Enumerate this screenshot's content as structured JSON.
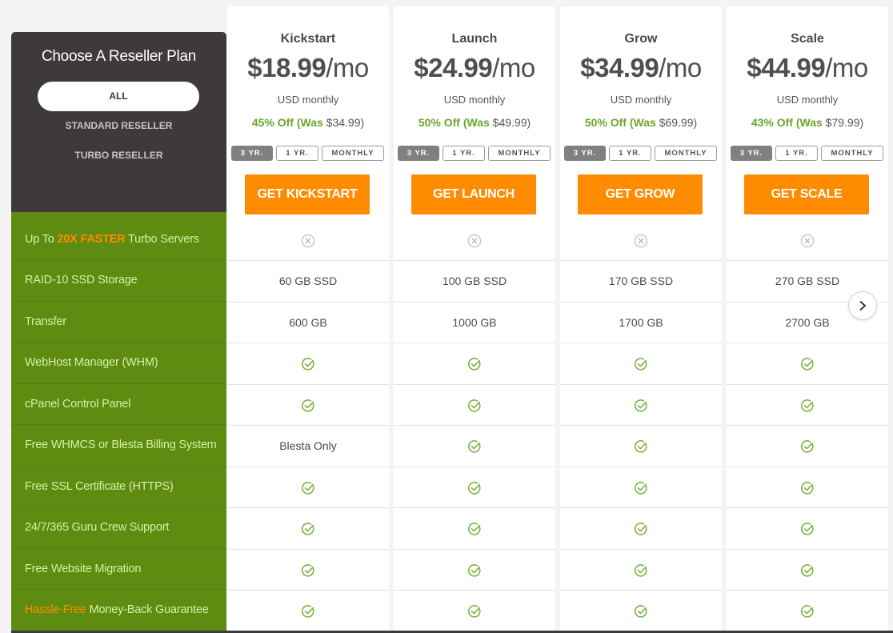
{
  "filter_panel": {
    "title": "Choose A Reseller Plan",
    "options": [
      {
        "label": "ALL",
        "selected": true
      },
      {
        "label": "STANDARD RESELLER",
        "selected": false
      },
      {
        "label": "TURBO RESELLER",
        "selected": false
      }
    ]
  },
  "features": [
    {
      "prefix": "Up To ",
      "highlight": "20X FASTER",
      "suffix": " Turbo Servers"
    },
    {
      "prefix": "RAID-10 SSD Storage",
      "highlight": "",
      "suffix": ""
    },
    {
      "prefix": "Transfer",
      "highlight": "",
      "suffix": ""
    },
    {
      "prefix": "WebHost Manager (WHM)",
      "highlight": "",
      "suffix": ""
    },
    {
      "prefix": "cPanel Control Panel",
      "highlight": "",
      "suffix": ""
    },
    {
      "prefix": "Free WHMCS or Blesta Billing System",
      "highlight": "",
      "suffix": ""
    },
    {
      "prefix": "Free SSL Certificate (HTTPS)",
      "highlight": "",
      "suffix": ""
    },
    {
      "prefix": "24/7/365 Guru Crew Support",
      "highlight": "",
      "suffix": ""
    },
    {
      "prefix": "Free Website Migration",
      "highlight": "",
      "suffix": ""
    },
    {
      "prefix": "",
      "highlight": "Hassle-Free",
      "suffix": " Money-Back Guarantee"
    }
  ],
  "term_options": [
    "3 YR.",
    "1 YR.",
    "MONTHLY"
  ],
  "selected_term": "3 YR.",
  "plans": [
    {
      "name": "Kickstart",
      "price": "$18.99",
      "per": "/mo",
      "billing": "USD monthly",
      "discount": "45% Off (Was",
      "was_price": "$34.99)",
      "cta": "GET KICKSTART",
      "cells": [
        "x-icon",
        "60 GB SSD",
        "600 GB",
        "check-icon",
        "check-icon",
        "Blesta Only",
        "check-icon",
        "check-icon",
        "check-icon",
        "check-icon"
      ]
    },
    {
      "name": "Launch",
      "price": "$24.99",
      "per": "/mo",
      "billing": "USD monthly",
      "discount": "50% Off (Was",
      "was_price": "$49.99)",
      "cta": "GET LAUNCH",
      "cells": [
        "x-icon",
        "100 GB SSD",
        "1000 GB",
        "check-icon",
        "check-icon",
        "check-icon",
        "check-icon",
        "check-icon",
        "check-icon",
        "check-icon"
      ]
    },
    {
      "name": "Grow",
      "price": "$34.99",
      "per": "/mo",
      "billing": "USD monthly",
      "discount": "50% Off (Was",
      "was_price": "$69.99)",
      "cta": "GET GROW",
      "cells": [
        "x-icon",
        "170 GB SSD",
        "1700 GB",
        "check-icon",
        "check-icon",
        "check-icon",
        "check-icon",
        "check-icon",
        "check-icon",
        "check-icon"
      ]
    },
    {
      "name": "Scale",
      "price": "$44.99",
      "per": "/mo",
      "billing": "USD monthly",
      "discount": "43% Off (Was",
      "was_price": "$79.99)",
      "cta": "GET SCALE",
      "cells": [
        "x-icon",
        "270 GB SSD",
        "2700 GB",
        "check-icon",
        "check-icon",
        "check-icon",
        "check-icon",
        "check-icon",
        "check-icon",
        "check-icon"
      ]
    }
  ],
  "navigation": {
    "next_icon": "chevron-right-icon"
  },
  "colors": {
    "accent_orange": "#ff8c00",
    "feature_green": "#5e8c10",
    "header_dark": "#3d393c",
    "discount_green": "#6aa62d",
    "check_green": "#7cb342",
    "x_gray": "#c8c8c8"
  }
}
